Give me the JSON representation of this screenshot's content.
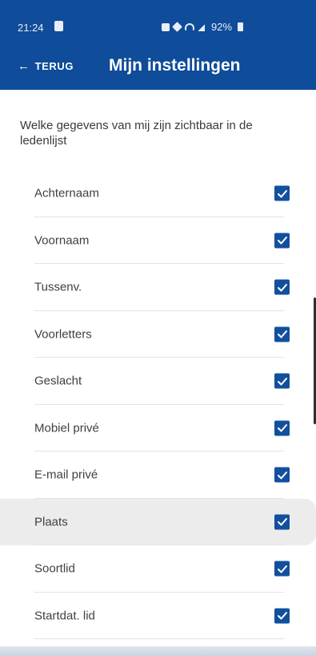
{
  "status_bar": {
    "time": "21:24",
    "battery": "92%",
    "icons": [
      "gallery-icon",
      "alarm-icon",
      "mute-icon",
      "wifi-icon",
      "signal-icon",
      "battery-icon"
    ]
  },
  "header": {
    "back_label": "TERUG",
    "title": "Mijn instellingen"
  },
  "intro_text": "Welke gegevens van mij zijn zichtbaar in de ledenlijst",
  "fields": [
    {
      "label": "Achternaam",
      "checked": true
    },
    {
      "label": "Voornaam",
      "checked": true
    },
    {
      "label": "Tussenv.",
      "checked": true
    },
    {
      "label": "Voorletters",
      "checked": true
    },
    {
      "label": "Geslacht",
      "checked": true
    },
    {
      "label": "Mobiel privé",
      "checked": true
    },
    {
      "label": "E-mail privé",
      "checked": true
    },
    {
      "label": "Plaats",
      "checked": true
    },
    {
      "label": "Soortlid",
      "checked": true
    },
    {
      "label": "Startdat. lid",
      "checked": true
    }
  ],
  "colors": {
    "app_bar": "#0f4c9a",
    "checkbox": "#12509f",
    "highlight_row": "#ececec"
  }
}
